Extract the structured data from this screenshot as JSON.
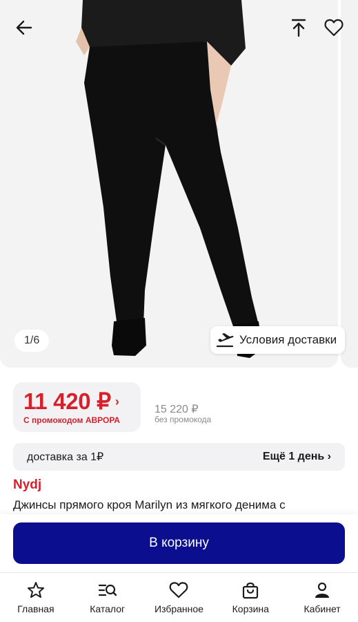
{
  "gallery": {
    "counter": "1/6",
    "delivery_chip": "Условия доставки"
  },
  "icons": {
    "back": "arrow-left",
    "share": "share-up",
    "favorite": "heart-outline",
    "delivery": "plane-departure"
  },
  "price": {
    "current": "11 420 ₽",
    "promo_label": "С промокодом  АВРОРА",
    "old": "15 220 ₽",
    "old_note": "без промокода"
  },
  "delivery": {
    "label": "доставка за 1₽",
    "more": "Ещё 1 день ›"
  },
  "product": {
    "brand": "Nydj",
    "title": "Джинсы прямого кроя Marilyn из мягкого денима с"
  },
  "cart": {
    "button": "В корзину"
  },
  "nav": {
    "items": [
      {
        "label": "Главная",
        "icon": "star"
      },
      {
        "label": "Каталог",
        "icon": "catalog-search"
      },
      {
        "label": "Избранное",
        "icon": "heart"
      },
      {
        "label": "Корзина",
        "icon": "bag"
      },
      {
        "label": "Кабинет",
        "icon": "user"
      }
    ]
  },
  "colors": {
    "accent_red": "#d6202b",
    "cart_blue": "#0b0f8f",
    "panel_grey": "#f2f2f4"
  }
}
